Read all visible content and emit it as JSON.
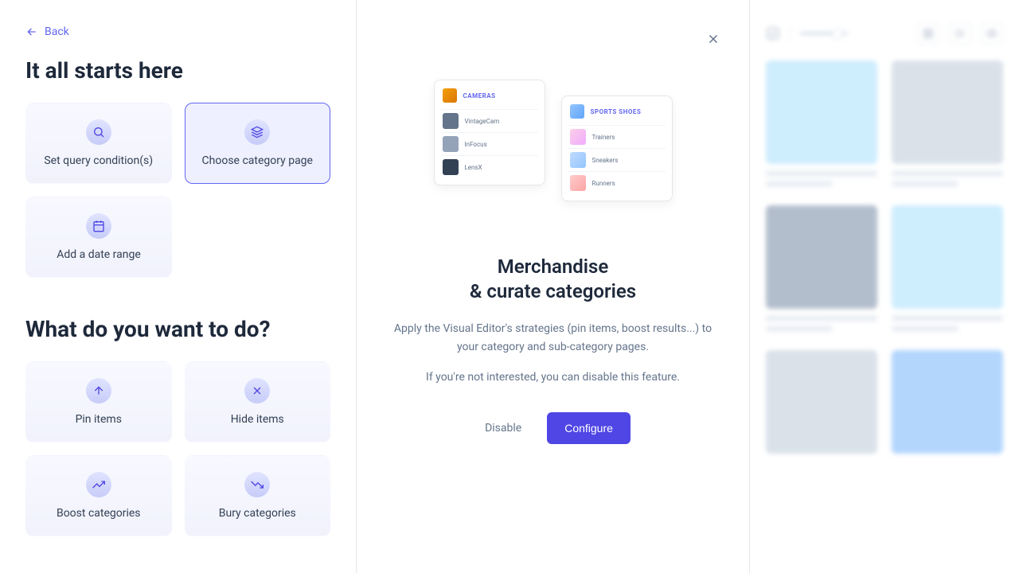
{
  "back_label": "Back",
  "section1_title": "It all starts here",
  "section2_title": "What do you want to do?",
  "start_options": [
    {
      "label": "Set query condition(s)"
    },
    {
      "label": "Choose category page"
    },
    {
      "label": "Add a date range"
    }
  ],
  "actions": [
    {
      "label": "Pin items"
    },
    {
      "label": "Hide items"
    },
    {
      "label": "Boost categories"
    },
    {
      "label": "Bury categories"
    }
  ],
  "modal": {
    "title_line1": "Merchandise",
    "title_line2": "& curate categories",
    "desc1": "Apply the Visual Editor's strategies (pin items, boost results...) to your category and sub-category pages.",
    "desc2": "If you're not interested, you can disable this feature.",
    "disable_label": "Disable",
    "configure_label": "Configure"
  },
  "illus": {
    "left_header": "CAMERAS",
    "left_rows": [
      "VintageCam",
      "InFocus",
      "LensX"
    ],
    "right_header": "SPORTS SHOES",
    "right_rows": [
      "Trainers",
      "Sneakers",
      "Runners"
    ]
  }
}
